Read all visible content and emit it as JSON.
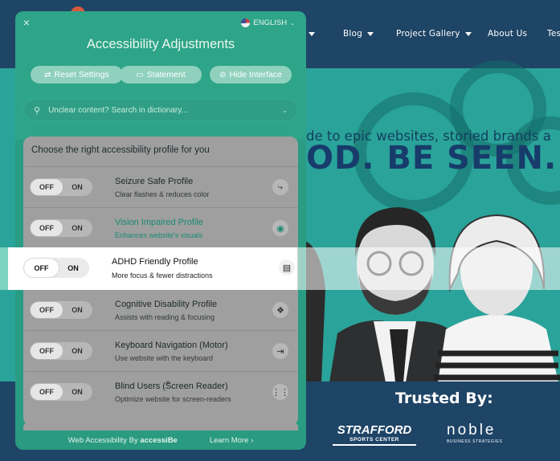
{
  "site": {
    "nav": [
      "Blog",
      "Project Gallery",
      "About Us",
      "Tes"
    ],
    "hero_tagline": "de to epic websites, storied brands a",
    "hero_headline": "OD. BE SEEN.",
    "trusted_title": "Trusted By:",
    "logo_strafford": "STRAFFORD",
    "logo_strafford_sub": "SPORTS CENTER",
    "logo_noble": "noble",
    "logo_noble_sub": "BUSINESS STRATEGIES"
  },
  "panel": {
    "close_icon": "×",
    "language": "ENGLISH",
    "title": "Accessibility Adjustments",
    "buttons": {
      "reset": "Reset Settings",
      "statement": "Statement",
      "hide": "Hide Interface"
    },
    "search_placeholder": "Unclear content? Search in dictionary...",
    "profiles_title": "Choose the right accessibility profile for you",
    "toggle_off": "OFF",
    "toggle_on": "ON",
    "profiles": [
      {
        "name": "Seizure Safe Profile",
        "desc": "Clear flashes & reduces color",
        "icon": "bolt-icon"
      },
      {
        "name": "Vision Impaired Profile",
        "desc": "Enhances website's visuals",
        "icon": "eye-icon"
      },
      {
        "name": "ADHD Friendly Profile",
        "desc": "More focus & fewer distractions",
        "icon": "focus-icon"
      },
      {
        "name": "Cognitive Disability Profile",
        "desc": "Assists with reading & focusing",
        "icon": "target-icon"
      },
      {
        "name": "Keyboard Navigation (Motor)",
        "desc": "Use website with the keyboard",
        "icon": "arrow-to-bar-icon"
      },
      {
        "name": "Blind Users (Screen Reader)",
        "desc": "Optimize website for screen-readers",
        "icon": "soundwave-icon"
      }
    ],
    "footer": {
      "by_label": "Web Accessibility By",
      "brand": "accessiBe",
      "learn_more": "Learn More ›"
    }
  },
  "colors": {
    "panel_green": "#2ea488",
    "site_navy": "#1e4466",
    "site_teal": "#2aa39a",
    "vision_highlight": "#1a8a72"
  }
}
